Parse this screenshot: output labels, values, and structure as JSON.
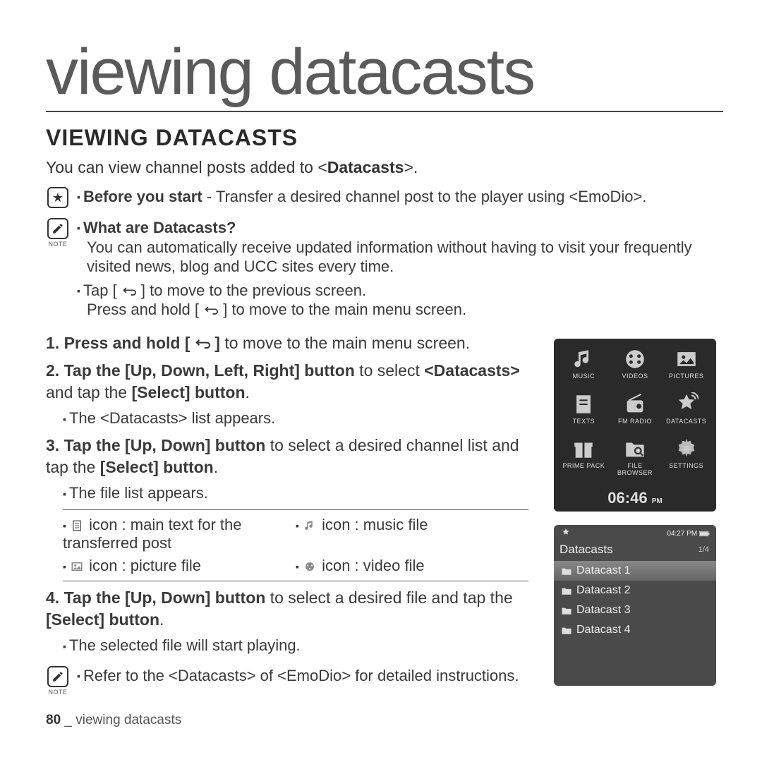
{
  "chapter_title": "viewing datacasts",
  "section_title": "VIEWING DATACASTS",
  "intro_prefix": "You can view channel posts added to <",
  "intro_bold": "Datacasts",
  "intro_suffix": ">.",
  "note_star": {
    "before_bold": "Before you start",
    "after": " - Transfer a desired channel post to the player using <EmoDio>."
  },
  "note_what": {
    "label": "NOTE",
    "heading": "What are Datacasts?",
    "body": "You can automatically receive updated information without having to visit your frequently visited news, blog and UCC sites every time.",
    "tap_line_pre": "Tap [ ",
    "tap_line_post": " ] to move to the previous screen.",
    "hold_line_pre": "Press and hold [ ",
    "hold_line_post": " ] to move to the main menu screen."
  },
  "steps": {
    "s1_pre": "1. Press and hold ",
    "s1_post": " to move to the main menu screen.",
    "s1_key_open": "[ ",
    "s1_key_close": " ]",
    "s2_a": "2. Tap the ",
    "s2_bold1": "[Up, Down, Left, Right] button",
    "s2_b": " to select ",
    "s2_bold2": "<Datacasts>",
    "s2_c": " and tap the ",
    "s2_bold3": "[Select] button",
    "s2_d": ".",
    "s2_sub": "The <Datacasts> list appears.",
    "s3_a": "3. Tap the ",
    "s3_bold1": "[Up, Down] button",
    "s3_b": " to select a desired channel list and tap the ",
    "s3_bold2": "[Select] button",
    "s3_c": ".",
    "s3_sub": "The file list appears.",
    "icons": {
      "text": " icon : main text for the transferred post",
      "music": " icon : music file",
      "picture": " icon : picture file",
      "video": " icon : video file"
    },
    "s4_a": "4. Tap the ",
    "s4_bold1": "[Up, Down] button",
    "s4_b": " to select a desired file and tap the ",
    "s4_bold2": "[Select] button",
    "s4_c": ".",
    "s4_sub": "The selected file will start playing."
  },
  "note_refer": {
    "label": "NOTE",
    "text": "Refer to the <Datacasts> of <EmoDio> for detailed instructions."
  },
  "footer": {
    "page": "80",
    "sep": " _ ",
    "title": "viewing datacasts"
  },
  "device1": {
    "items": [
      "MUSIC",
      "VIDEOS",
      "PICTURES",
      "TEXTS",
      "FM RADIO",
      "DATACASTS",
      "PRIME PACK",
      "FILE BROWSER",
      "SETTINGS"
    ],
    "time": "06:46",
    "ampm": "PM"
  },
  "device2": {
    "status_time": "04:27 PM",
    "title": "Datacasts",
    "count": "1/4",
    "rows": [
      "Datacast 1",
      "Datacast 2",
      "Datacast 3",
      "Datacast 4"
    ]
  }
}
